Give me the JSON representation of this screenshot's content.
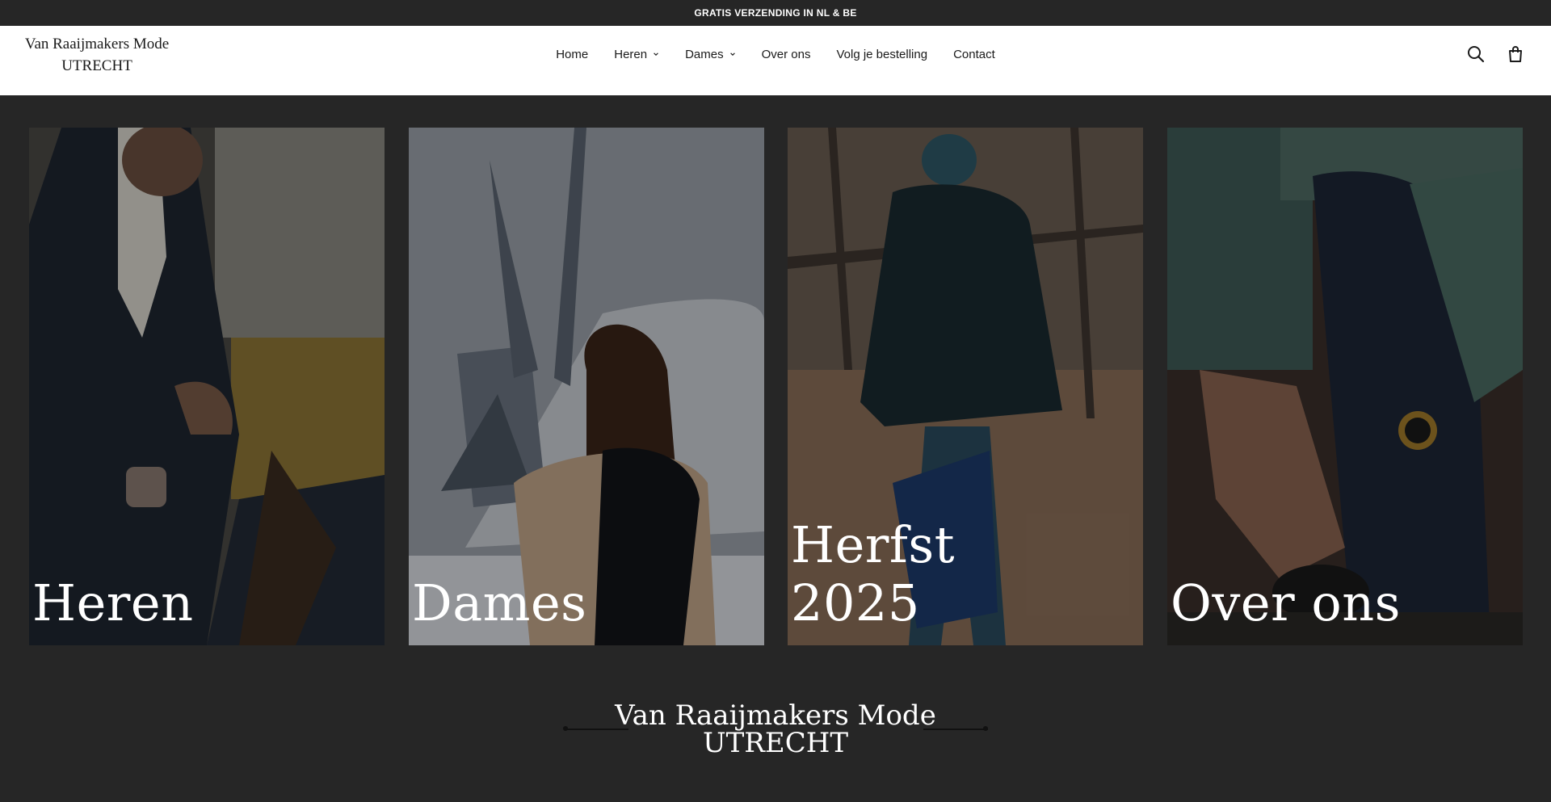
{
  "announcement": {
    "text": "GRATIS VERZENDING IN NL & BE"
  },
  "header": {
    "logo": {
      "line1": "Van Raaijmakers Mode",
      "line2": "UTRECHT"
    },
    "nav": [
      {
        "label": "Home",
        "has_dropdown": false
      },
      {
        "label": "Heren",
        "has_dropdown": true
      },
      {
        "label": "Dames",
        "has_dropdown": true
      },
      {
        "label": "Over ons",
        "has_dropdown": false
      },
      {
        "label": "Volg je bestelling",
        "has_dropdown": false
      },
      {
        "label": "Contact",
        "has_dropdown": false
      }
    ],
    "icons": {
      "search": "search-icon",
      "cart": "shopping-bag-icon"
    }
  },
  "tiles": [
    {
      "line1": "Heren",
      "line2": ""
    },
    {
      "line1": "Dames",
      "line2": ""
    },
    {
      "line1": "Herfst",
      "line2": "2025"
    },
    {
      "line1": "Over ons",
      "line2": ""
    }
  ],
  "footer_brand": {
    "line1": "Van Raaijmakers Mode",
    "line2": "UTRECHT"
  },
  "colors": {
    "background": "#262626",
    "header_bg": "#ffffff",
    "text_dark": "#1a1a1a",
    "text_light": "#ffffff"
  }
}
